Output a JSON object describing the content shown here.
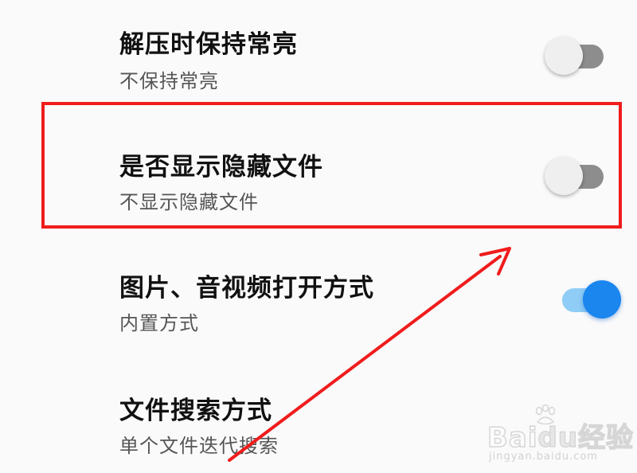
{
  "settings": [
    {
      "title": "解压时保持常亮",
      "subtitle": "不保持常亮",
      "toggle_on": false
    },
    {
      "title": "是否显示隐藏文件",
      "subtitle": "不显示隐藏文件",
      "toggle_on": false
    },
    {
      "title": "图片、音视频打开方式",
      "subtitle": "内置方式",
      "toggle_on": true
    },
    {
      "title": "文件搜索方式",
      "subtitle": "单个文件迭代搜索"
    }
  ],
  "annotation": {
    "color": "#f01c1c"
  },
  "watermark": {
    "logo_bai": "Bai",
    "logo_du": "du",
    "logo_cn": "经验",
    "url": "jingyan.baidu.com"
  },
  "colors": {
    "toggle_on_knob": "#1a86ee",
    "toggle_on_track": "#8fcdf6",
    "toggle_off_track": "#8d8d8d",
    "toggle_off_knob": "#efefef"
  }
}
